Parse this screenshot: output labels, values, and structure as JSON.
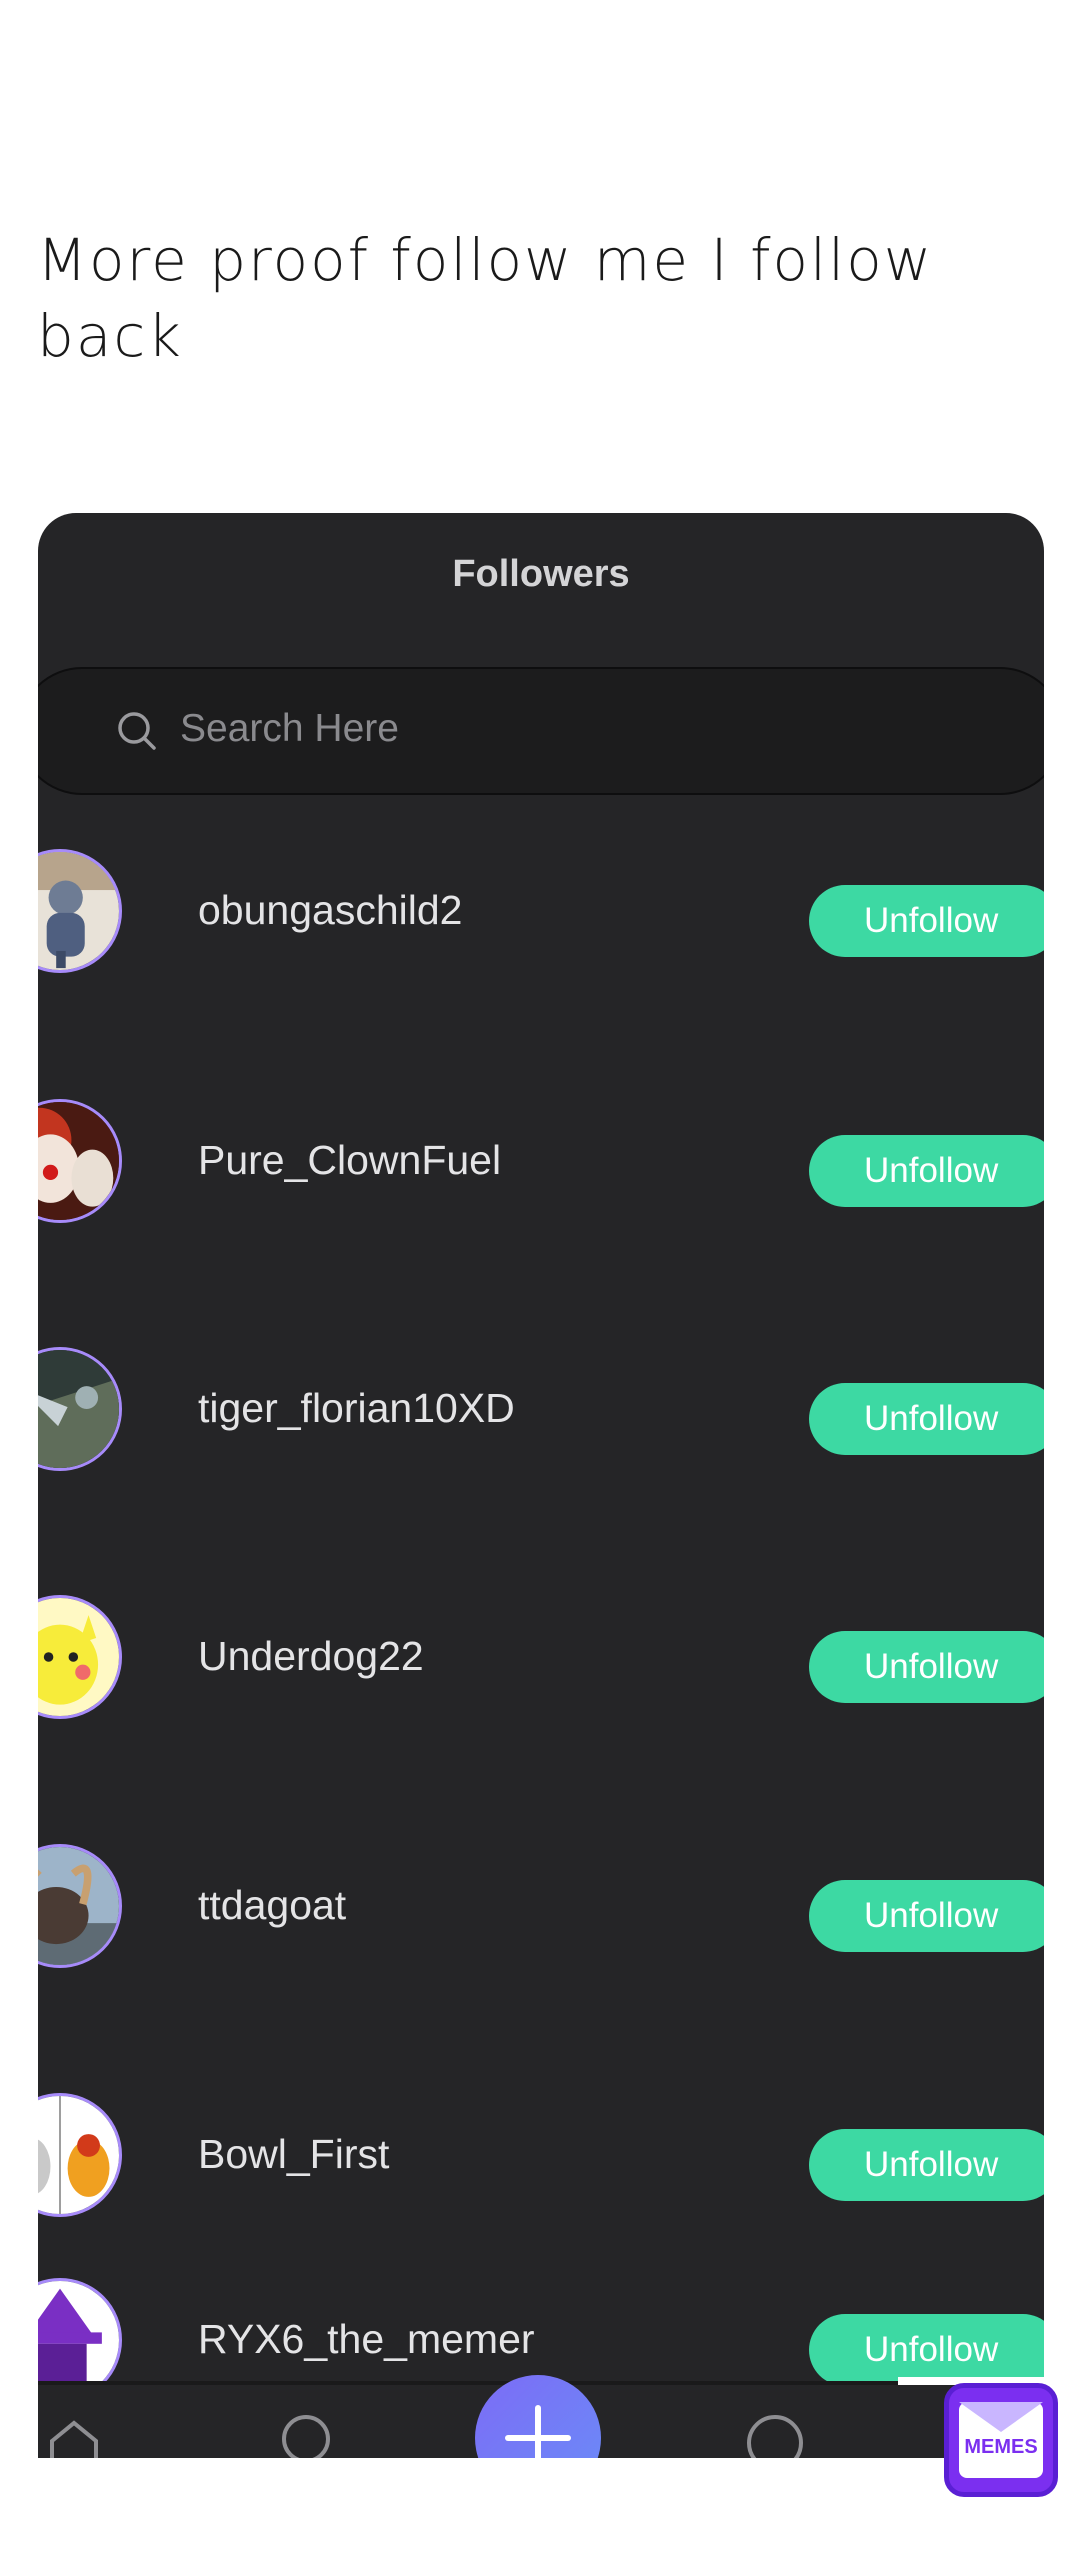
{
  "caption": "More proof follow me I follow back",
  "screen": {
    "title": "Followers",
    "search": {
      "placeholder": "Search Here"
    },
    "followers": [
      {
        "username": "obungaschild2",
        "button": "Unfollow"
      },
      {
        "username": "Pure_ClownFuel",
        "button": "Unfollow"
      },
      {
        "username": "tiger_florian10XD",
        "button": "Unfollow"
      },
      {
        "username": "Underdog22",
        "button": "Unfollow"
      },
      {
        "username": "ttdagoat",
        "button": "Unfollow"
      },
      {
        "username": "Bowl_First",
        "button": "Unfollow"
      },
      {
        "username": "RYX6_the_memer",
        "button": "Unfollow"
      }
    ],
    "tabbar": [
      "home-icon",
      "search-icon",
      "add-icon",
      "chat-icon"
    ]
  },
  "watermark": {
    "text": "MEMES"
  },
  "colors": {
    "panel": "#252527",
    "accent": "#3dd9a3",
    "avatar_ring": "#a78bfa",
    "fab": "#7c6cf5"
  }
}
